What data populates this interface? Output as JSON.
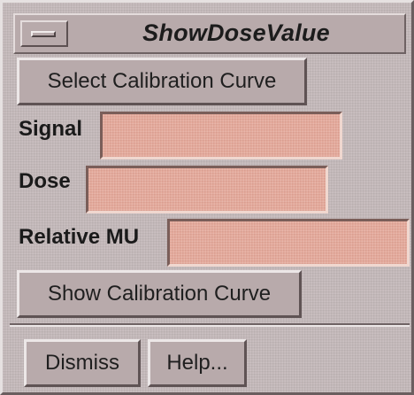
{
  "window": {
    "title": "ShowDoseValue"
  },
  "buttons": {
    "select_calibration": "Select Calibration Curve",
    "show_calibration": "Show Calibration Curve",
    "dismiss": "Dismiss",
    "help": "Help..."
  },
  "fields": {
    "signal": {
      "label": "Signal",
      "value": ""
    },
    "dose": {
      "label": "Dose",
      "value": ""
    },
    "relative_mu": {
      "label": "Relative MU",
      "value": ""
    }
  },
  "colors": {
    "window_bg": "#c4b9ba",
    "field_bg": "#e4a99b"
  }
}
